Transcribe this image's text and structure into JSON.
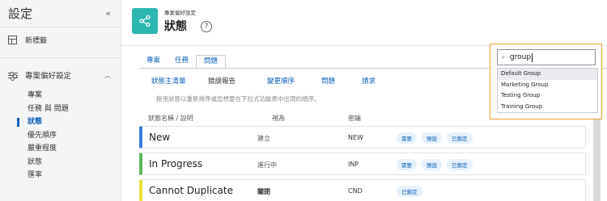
{
  "sidebar": {
    "title": "設定",
    "collapse_icon": "«",
    "new_label": "新標籤",
    "group_label": "專案偏好設定",
    "items": [
      {
        "label": "專案",
        "active": false
      },
      {
        "label": "任務 與 問題",
        "active": false
      },
      {
        "label": "狀態",
        "active": true
      },
      {
        "label": "優先順序",
        "active": false
      },
      {
        "label": "嚴重程度",
        "active": false
      },
      {
        "label": "狀態",
        "active": false
      },
      {
        "label": "匯率",
        "active": false
      }
    ]
  },
  "header": {
    "subtitle": "專案偏好設定",
    "title": "狀態",
    "help": "?"
  },
  "tabs": [
    "專案",
    "任務",
    "問題"
  ],
  "subtabs": [
    "狀態主清單",
    "錯誤報告",
    "變更順序",
    "問題",
    "請求"
  ],
  "hint": "拖曳狀態以重新排序或您想要在下拉式功能表中出現的順序。",
  "table": {
    "columns": [
      "狀態名稱 / 說明",
      "視為",
      "密鑰"
    ],
    "rows": [
      {
        "name": "New",
        "view": "建立",
        "key": "NEW",
        "tags": [
          "需要",
          "預設",
          "已鎖定"
        ],
        "color": "#3b7dd8"
      },
      {
        "name": "In Progress",
        "view": "進行中",
        "key": "INP",
        "tags": [
          "需要",
          "預設",
          "已鎖定"
        ],
        "color": "#5cb85c"
      },
      {
        "name": "Cannot Duplicate",
        "view": "關閉",
        "key": "CND",
        "tags": [
          "已鎖定"
        ],
        "color": "#e8e23a"
      }
    ]
  },
  "search": {
    "icon": "search-icon",
    "query": "group",
    "options": [
      "Default Group",
      "Marketing Group",
      "Testing Group",
      "Training Group"
    ]
  },
  "colors": {
    "accent": "#0a5fb4",
    "app_icon": "#2cb7b0",
    "popup_border": "#f0a030"
  }
}
